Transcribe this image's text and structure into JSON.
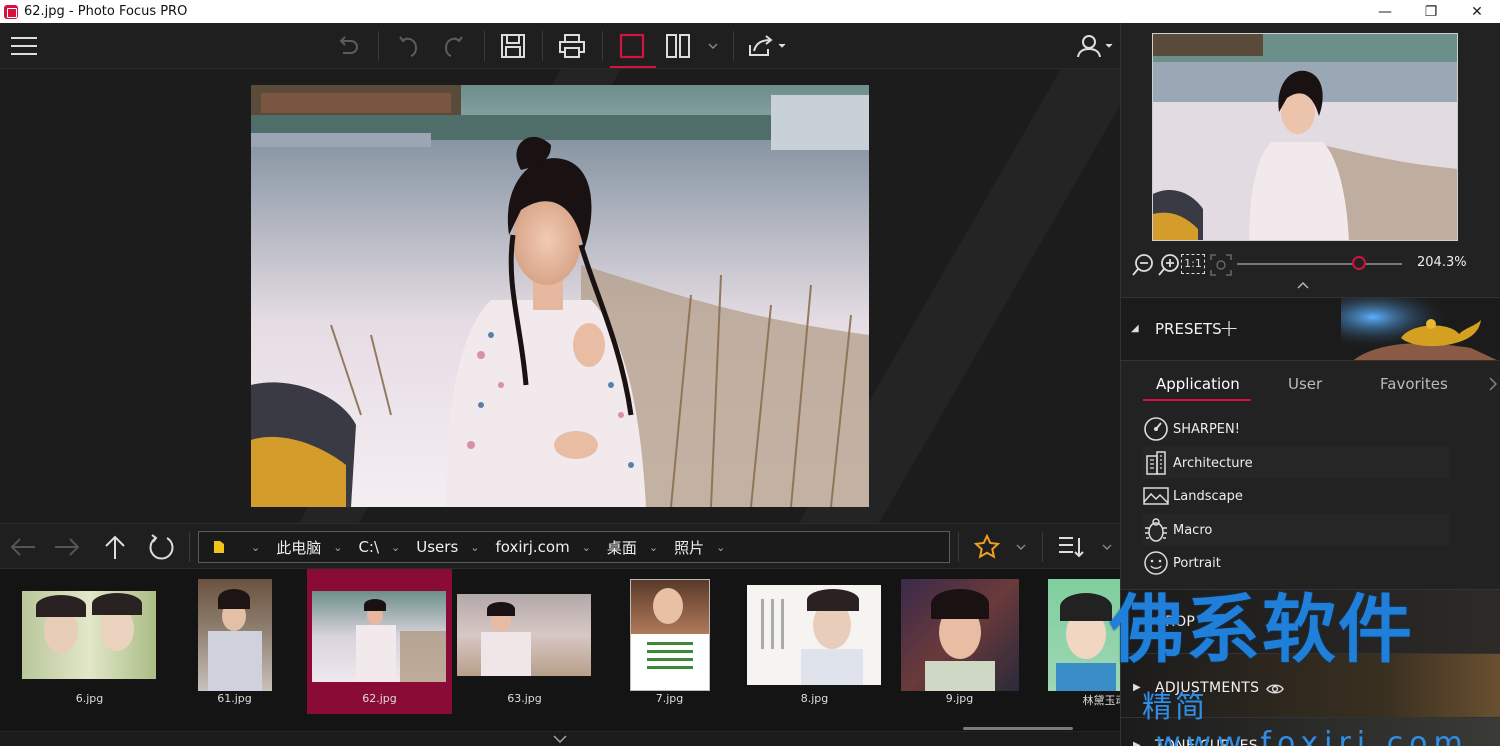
{
  "window": {
    "title": "62.jpg - Photo Focus PRO",
    "minimize": "—",
    "maximize": "❐",
    "close": "✕"
  },
  "navigation": {
    "breadcrumb": [
      {
        "label": ""
      },
      {
        "label": "此电脑"
      },
      {
        "label": "C:\\"
      },
      {
        "label": "Users"
      },
      {
        "label": "foxirj.com"
      },
      {
        "label": "桌面"
      },
      {
        "label": "照片"
      }
    ]
  },
  "filmstrip": {
    "items": [
      {
        "caption": "6.jpg"
      },
      {
        "caption": "61.jpg"
      },
      {
        "caption": "62.jpg",
        "selected": true
      },
      {
        "caption": "63.jpg"
      },
      {
        "caption": "7.jpg"
      },
      {
        "caption": "8.jpg"
      },
      {
        "caption": "9.jpg"
      },
      {
        "caption": "林黛玉动"
      }
    ]
  },
  "zoom": {
    "value": "204.3%",
    "level": 0.74,
    "actual_size_label": "1:1"
  },
  "presets": {
    "title": "PRESETS",
    "add_icon": "+",
    "tabs": [
      {
        "label": "Application",
        "active": true
      },
      {
        "label": "User"
      },
      {
        "label": "Favorites"
      }
    ],
    "items": [
      {
        "label": "SHARPEN!",
        "icon": "gauge-icon"
      },
      {
        "label": "Architecture",
        "icon": "building-icon"
      },
      {
        "label": "Landscape",
        "icon": "landscape-icon"
      },
      {
        "label": "Macro",
        "icon": "bug-icon"
      },
      {
        "label": "Portrait",
        "icon": "face-icon"
      }
    ]
  },
  "sections": {
    "crop": "CROP",
    "adjustments": "ADJUSTMENTS",
    "tone_curves": "TONE CURVES"
  },
  "watermark": {
    "big": "佛系软件",
    "small": "精简",
    "url": "www.foxirj.com"
  },
  "colors": {
    "accent": "#d4123f",
    "selected_thumb": "#8a0b35",
    "watermark": "#1f7fd9"
  }
}
